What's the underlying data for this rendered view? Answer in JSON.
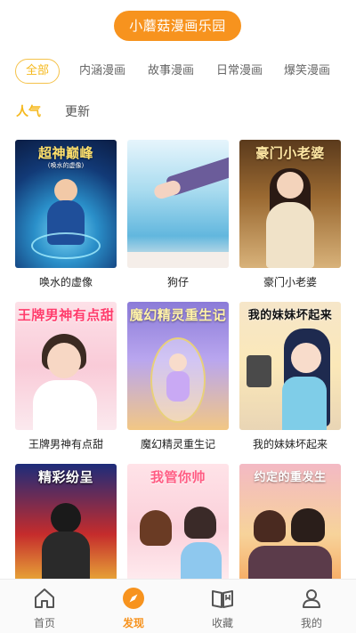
{
  "header": {
    "title": "小蘑菇漫画乐园"
  },
  "categories": {
    "items": [
      {
        "label": "全部",
        "active": true
      },
      {
        "label": "内涵漫画",
        "active": false
      },
      {
        "label": "故事漫画",
        "active": false
      },
      {
        "label": "日常漫画",
        "active": false
      },
      {
        "label": "爆笑漫画",
        "active": false
      }
    ]
  },
  "sort": {
    "items": [
      {
        "label": "人气",
        "active": true
      },
      {
        "label": "更新",
        "active": false
      }
    ]
  },
  "comics": [
    {
      "title": "唤水的虚像",
      "cover_text": "超神巅峰",
      "cover_sub": "(唤水的虚像)"
    },
    {
      "title": "狗仔",
      "cover_text": "",
      "cover_sub": ""
    },
    {
      "title": "豪门小老婆",
      "cover_text": "豪门小老婆",
      "cover_sub": ""
    },
    {
      "title": "王牌男神有点甜",
      "cover_text": "王牌男神有点甜",
      "cover_sub": ""
    },
    {
      "title": "魔幻精灵重生记",
      "cover_text": "魔幻精灵重生记",
      "cover_sub": ""
    },
    {
      "title": "我的妹妹坏起来",
      "cover_text": "我的妹妹坏起来",
      "cover_sub": ""
    },
    {
      "title": "",
      "cover_text": "精彩纷呈",
      "cover_sub": ""
    },
    {
      "title": "",
      "cover_text": "我管你帅",
      "cover_sub": ""
    },
    {
      "title": "",
      "cover_text": "约定的重发生",
      "cover_sub": ""
    }
  ],
  "tabbar": {
    "items": [
      {
        "label": "首页",
        "icon": "home-icon",
        "active": false
      },
      {
        "label": "发现",
        "icon": "compass-icon",
        "active": true
      },
      {
        "label": "收藏",
        "icon": "book-icon",
        "active": false
      },
      {
        "label": "我的",
        "icon": "user-icon",
        "active": false
      }
    ]
  },
  "colors": {
    "accent": "#f7931e",
    "highlight": "#f5b81b"
  }
}
